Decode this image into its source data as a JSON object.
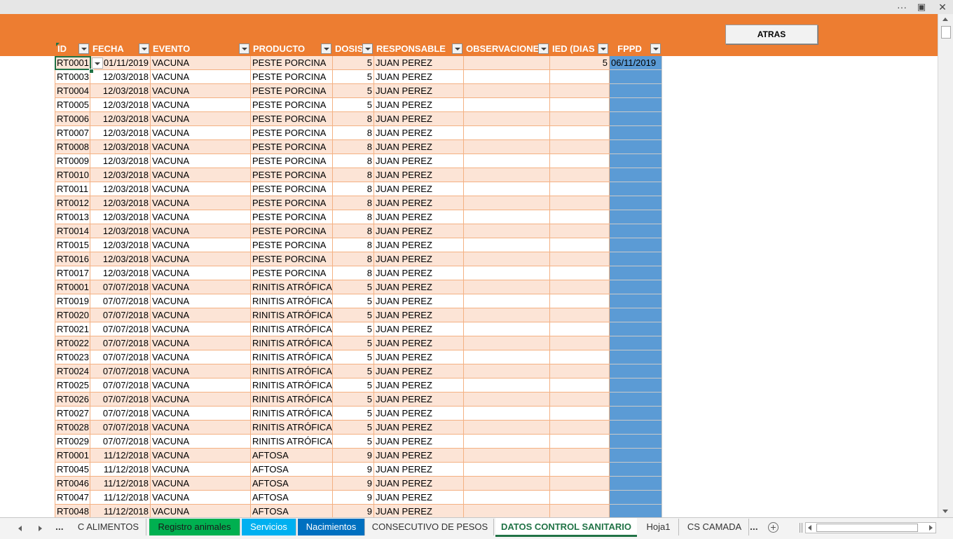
{
  "window": {
    "more_label": "···",
    "restore_label": "▣",
    "close_label": "✕"
  },
  "header": {
    "atras_label": "ATRAS"
  },
  "columns": [
    "ID",
    "FECHA",
    "EVENTO",
    "PRODUCTO",
    "DOSIS",
    "RESPONSABLE",
    "OBSERVACIONES",
    "IED (DIAS",
    "FPPD"
  ],
  "rows": [
    [
      "RT0001",
      "01/11/2019",
      "VACUNA",
      "PESTE PORCINA",
      "5",
      "JUAN PEREZ",
      "",
      "5",
      "06/11/2019"
    ],
    [
      "RT0003",
      "12/03/2018",
      "VACUNA",
      "PESTE PORCINA",
      "5",
      "JUAN PEREZ",
      "",
      "",
      ""
    ],
    [
      "RT0004",
      "12/03/2018",
      "VACUNA",
      "PESTE PORCINA",
      "5",
      "JUAN PEREZ",
      "",
      "",
      ""
    ],
    [
      "RT0005",
      "12/03/2018",
      "VACUNA",
      "PESTE PORCINA",
      "5",
      "JUAN PEREZ",
      "",
      "",
      ""
    ],
    [
      "RT0006",
      "12/03/2018",
      "VACUNA",
      "PESTE PORCINA",
      "8",
      "JUAN PEREZ",
      "",
      "",
      ""
    ],
    [
      "RT0007",
      "12/03/2018",
      "VACUNA",
      "PESTE PORCINA",
      "8",
      "JUAN PEREZ",
      "",
      "",
      ""
    ],
    [
      "RT0008",
      "12/03/2018",
      "VACUNA",
      "PESTE PORCINA",
      "8",
      "JUAN PEREZ",
      "",
      "",
      ""
    ],
    [
      "RT0009",
      "12/03/2018",
      "VACUNA",
      "PESTE PORCINA",
      "8",
      "JUAN PEREZ",
      "",
      "",
      ""
    ],
    [
      "RT0010",
      "12/03/2018",
      "VACUNA",
      "PESTE PORCINA",
      "8",
      "JUAN PEREZ",
      "",
      "",
      ""
    ],
    [
      "RT0011",
      "12/03/2018",
      "VACUNA",
      "PESTE PORCINA",
      "8",
      "JUAN PEREZ",
      "",
      "",
      ""
    ],
    [
      "RT0012",
      "12/03/2018",
      "VACUNA",
      "PESTE PORCINA",
      "8",
      "JUAN PEREZ",
      "",
      "",
      ""
    ],
    [
      "RT0013",
      "12/03/2018",
      "VACUNA",
      "PESTE PORCINA",
      "8",
      "JUAN PEREZ",
      "",
      "",
      ""
    ],
    [
      "RT0014",
      "12/03/2018",
      "VACUNA",
      "PESTE PORCINA",
      "8",
      "JUAN PEREZ",
      "",
      "",
      ""
    ],
    [
      "RT0015",
      "12/03/2018",
      "VACUNA",
      "PESTE PORCINA",
      "8",
      "JUAN PEREZ",
      "",
      "",
      ""
    ],
    [
      "RT0016",
      "12/03/2018",
      "VACUNA",
      "PESTE PORCINA",
      "8",
      "JUAN PEREZ",
      "",
      "",
      ""
    ],
    [
      "RT0017",
      "12/03/2018",
      "VACUNA",
      "PESTE PORCINA",
      "8",
      "JUAN PEREZ",
      "",
      "",
      ""
    ],
    [
      "RT0001",
      "07/07/2018",
      "VACUNA",
      "RINITIS ATRÓFICA",
      "5",
      "JUAN PEREZ",
      "",
      "",
      ""
    ],
    [
      "RT0019",
      "07/07/2018",
      "VACUNA",
      "RINITIS ATRÓFICA",
      "5",
      "JUAN PEREZ",
      "",
      "",
      ""
    ],
    [
      "RT0020",
      "07/07/2018",
      "VACUNA",
      "RINITIS ATRÓFICA",
      "5",
      "JUAN PEREZ",
      "",
      "",
      ""
    ],
    [
      "RT0021",
      "07/07/2018",
      "VACUNA",
      "RINITIS ATRÓFICA",
      "5",
      "JUAN PEREZ",
      "",
      "",
      ""
    ],
    [
      "RT0022",
      "07/07/2018",
      "VACUNA",
      "RINITIS ATRÓFICA",
      "5",
      "JUAN PEREZ",
      "",
      "",
      ""
    ],
    [
      "RT0023",
      "07/07/2018",
      "VACUNA",
      "RINITIS ATRÓFICA",
      "5",
      "JUAN PEREZ",
      "",
      "",
      ""
    ],
    [
      "RT0024",
      "07/07/2018",
      "VACUNA",
      "RINITIS ATRÓFICA",
      "5",
      "JUAN PEREZ",
      "",
      "",
      ""
    ],
    [
      "RT0025",
      "07/07/2018",
      "VACUNA",
      "RINITIS ATRÓFICA",
      "5",
      "JUAN PEREZ",
      "",
      "",
      ""
    ],
    [
      "RT0026",
      "07/07/2018",
      "VACUNA",
      "RINITIS ATRÓFICA",
      "5",
      "JUAN PEREZ",
      "",
      "",
      ""
    ],
    [
      "RT0027",
      "07/07/2018",
      "VACUNA",
      "RINITIS ATRÓFICA",
      "5",
      "JUAN PEREZ",
      "",
      "",
      ""
    ],
    [
      "RT0028",
      "07/07/2018",
      "VACUNA",
      "RINITIS ATRÓFICA",
      "5",
      "JUAN PEREZ",
      "",
      "",
      ""
    ],
    [
      "RT0029",
      "07/07/2018",
      "VACUNA",
      "RINITIS ATRÓFICA",
      "5",
      "JUAN PEREZ",
      "",
      "",
      ""
    ],
    [
      "RT0001",
      "11/12/2018",
      "VACUNA",
      "AFTOSA",
      "9",
      "JUAN PEREZ",
      "",
      "",
      ""
    ],
    [
      "RT0045",
      "11/12/2018",
      "VACUNA",
      "AFTOSA",
      "9",
      "JUAN PEREZ",
      "",
      "",
      ""
    ],
    [
      "RT0046",
      "11/12/2018",
      "VACUNA",
      "AFTOSA",
      "9",
      "JUAN PEREZ",
      "",
      "",
      ""
    ],
    [
      "RT0047",
      "11/12/2018",
      "VACUNA",
      "AFTOSA",
      "9",
      "JUAN PEREZ",
      "",
      "",
      ""
    ],
    [
      "RT0048",
      "11/12/2018",
      "VACUNA",
      "AFTOSA",
      "9",
      "JUAN PEREZ",
      "",
      "",
      ""
    ]
  ],
  "sheet_tabs": [
    {
      "label": "C ALIMENTOS",
      "color": ""
    },
    {
      "label": "Registro animales",
      "color": "#00b050"
    },
    {
      "label": "Servicios",
      "color": "#00b0f0"
    },
    {
      "label": "Nacimientos",
      "color": "#0070c0"
    },
    {
      "label": "CONSECUTIVO DE PESOS",
      "color": ""
    },
    {
      "label": "DATOS CONTROL SANITARIO",
      "color": ""
    },
    {
      "label": "Hoja1",
      "color": ""
    },
    {
      "label": "CS CAMADA",
      "color": ""
    }
  ],
  "active_sheet": "DATOS CONTROL SANITARIO",
  "tabbar": {
    "more_left": "...",
    "more_right": "...",
    "add_label": "+"
  },
  "colors": {
    "header_orange": "#ed7d31",
    "band_row": "#fce4d6",
    "fppd_fill": "#5b9bd5",
    "accent_green": "#217346"
  }
}
